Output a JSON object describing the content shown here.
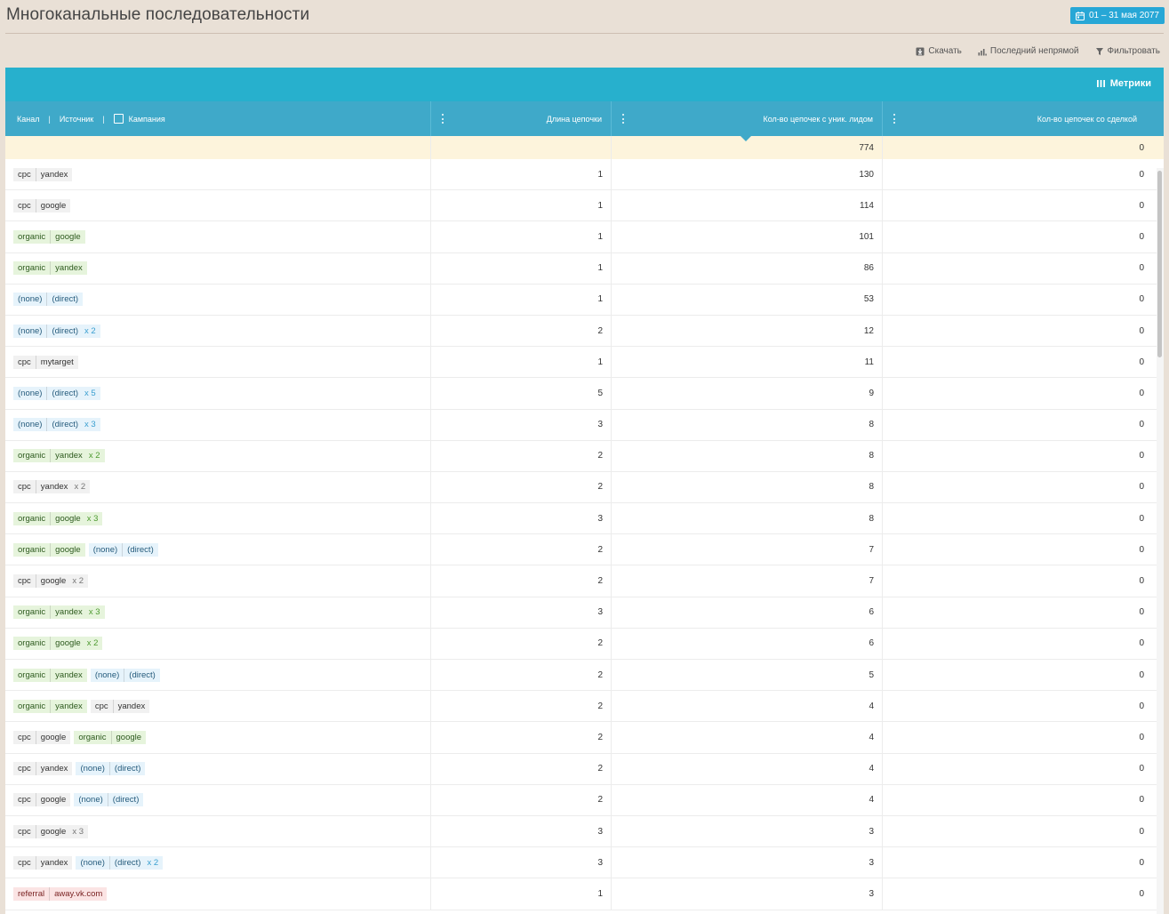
{
  "header": {
    "title": "Многоканальные последовательности",
    "date_range": "01 – 31 мая 2077"
  },
  "actions": {
    "download": "Скачать",
    "attribution": "Последний непрямой",
    "filter": "Фильтровать"
  },
  "metrics_label": "Метрики",
  "columns": {
    "channel": "Канал",
    "source": "Источник",
    "campaign": "Кампания",
    "length": "Длина цепочки",
    "leads": "Кол-во цепочек с уник. лидом",
    "deals": "Кол-во цепочек со сделкой"
  },
  "totals": {
    "leads": "774",
    "deals": "0"
  },
  "rows": [
    {
      "chain": [
        {
          "type": "cpc",
          "channel": "cpc",
          "source": "yandex",
          "mult": ""
        }
      ],
      "length": "1",
      "leads": "130",
      "deals": "0"
    },
    {
      "chain": [
        {
          "type": "cpc",
          "channel": "cpc",
          "source": "google",
          "mult": ""
        }
      ],
      "length": "1",
      "leads": "114",
      "deals": "0"
    },
    {
      "chain": [
        {
          "type": "organic",
          "channel": "organic",
          "source": "google",
          "mult": ""
        }
      ],
      "length": "1",
      "leads": "101",
      "deals": "0"
    },
    {
      "chain": [
        {
          "type": "organic",
          "channel": "organic",
          "source": "yandex",
          "mult": ""
        }
      ],
      "length": "1",
      "leads": "86",
      "deals": "0"
    },
    {
      "chain": [
        {
          "type": "none",
          "channel": "(none)",
          "source": "(direct)",
          "mult": ""
        }
      ],
      "length": "1",
      "leads": "53",
      "deals": "0"
    },
    {
      "chain": [
        {
          "type": "none",
          "channel": "(none)",
          "source": "(direct)",
          "mult": "x 2"
        }
      ],
      "length": "2",
      "leads": "12",
      "deals": "0"
    },
    {
      "chain": [
        {
          "type": "cpc",
          "channel": "cpc",
          "source": "mytarget",
          "mult": ""
        }
      ],
      "length": "1",
      "leads": "11",
      "deals": "0"
    },
    {
      "chain": [
        {
          "type": "none",
          "channel": "(none)",
          "source": "(direct)",
          "mult": "x 5"
        }
      ],
      "length": "5",
      "leads": "9",
      "deals": "0"
    },
    {
      "chain": [
        {
          "type": "none",
          "channel": "(none)",
          "source": "(direct)",
          "mult": "x 3"
        }
      ],
      "length": "3",
      "leads": "8",
      "deals": "0"
    },
    {
      "chain": [
        {
          "type": "organic",
          "channel": "organic",
          "source": "yandex",
          "mult": "x 2"
        }
      ],
      "length": "2",
      "leads": "8",
      "deals": "0"
    },
    {
      "chain": [
        {
          "type": "cpc",
          "channel": "cpc",
          "source": "yandex",
          "mult": "x 2"
        }
      ],
      "length": "2",
      "leads": "8",
      "deals": "0"
    },
    {
      "chain": [
        {
          "type": "organic",
          "channel": "organic",
          "source": "google",
          "mult": "x 3"
        }
      ],
      "length": "3",
      "leads": "8",
      "deals": "0"
    },
    {
      "chain": [
        {
          "type": "organic",
          "channel": "organic",
          "source": "google",
          "mult": ""
        },
        {
          "type": "none",
          "channel": "(none)",
          "source": "(direct)",
          "mult": ""
        }
      ],
      "length": "2",
      "leads": "7",
      "deals": "0"
    },
    {
      "chain": [
        {
          "type": "cpc",
          "channel": "cpc",
          "source": "google",
          "mult": "x 2"
        }
      ],
      "length": "2",
      "leads": "7",
      "deals": "0"
    },
    {
      "chain": [
        {
          "type": "organic",
          "channel": "organic",
          "source": "yandex",
          "mult": "x 3"
        }
      ],
      "length": "3",
      "leads": "6",
      "deals": "0"
    },
    {
      "chain": [
        {
          "type": "organic",
          "channel": "organic",
          "source": "google",
          "mult": "x 2"
        }
      ],
      "length": "2",
      "leads": "6",
      "deals": "0"
    },
    {
      "chain": [
        {
          "type": "organic",
          "channel": "organic",
          "source": "yandex",
          "mult": ""
        },
        {
          "type": "none",
          "channel": "(none)",
          "source": "(direct)",
          "mult": ""
        }
      ],
      "length": "2",
      "leads": "5",
      "deals": "0"
    },
    {
      "chain": [
        {
          "type": "organic",
          "channel": "organic",
          "source": "yandex",
          "mult": ""
        },
        {
          "type": "cpc",
          "channel": "cpc",
          "source": "yandex",
          "mult": ""
        }
      ],
      "length": "2",
      "leads": "4",
      "deals": "0"
    },
    {
      "chain": [
        {
          "type": "cpc",
          "channel": "cpc",
          "source": "google",
          "mult": ""
        },
        {
          "type": "organic",
          "channel": "organic",
          "source": "google",
          "mult": ""
        }
      ],
      "length": "2",
      "leads": "4",
      "deals": "0"
    },
    {
      "chain": [
        {
          "type": "cpc",
          "channel": "cpc",
          "source": "yandex",
          "mult": ""
        },
        {
          "type": "none",
          "channel": "(none)",
          "source": "(direct)",
          "mult": ""
        }
      ],
      "length": "2",
      "leads": "4",
      "deals": "0"
    },
    {
      "chain": [
        {
          "type": "cpc",
          "channel": "cpc",
          "source": "google",
          "mult": ""
        },
        {
          "type": "none",
          "channel": "(none)",
          "source": "(direct)",
          "mult": ""
        }
      ],
      "length": "2",
      "leads": "4",
      "deals": "0"
    },
    {
      "chain": [
        {
          "type": "cpc",
          "channel": "cpc",
          "source": "google",
          "mult": "x 3"
        }
      ],
      "length": "3",
      "leads": "3",
      "deals": "0"
    },
    {
      "chain": [
        {
          "type": "cpc",
          "channel": "cpc",
          "source": "yandex",
          "mult": ""
        },
        {
          "type": "none",
          "channel": "(none)",
          "source": "(direct)",
          "mult": "x 2"
        }
      ],
      "length": "3",
      "leads": "3",
      "deals": "0"
    },
    {
      "chain": [
        {
          "type": "referral",
          "channel": "referral",
          "source": "away.vk.com",
          "mult": ""
        }
      ],
      "length": "1",
      "leads": "3",
      "deals": "0"
    }
  ],
  "icons": {
    "calendar": "calendar-icon",
    "download": "download-icon",
    "attribution": "bar-chart-icon",
    "filter": "filter-icon",
    "metrics": "columns-icon"
  }
}
